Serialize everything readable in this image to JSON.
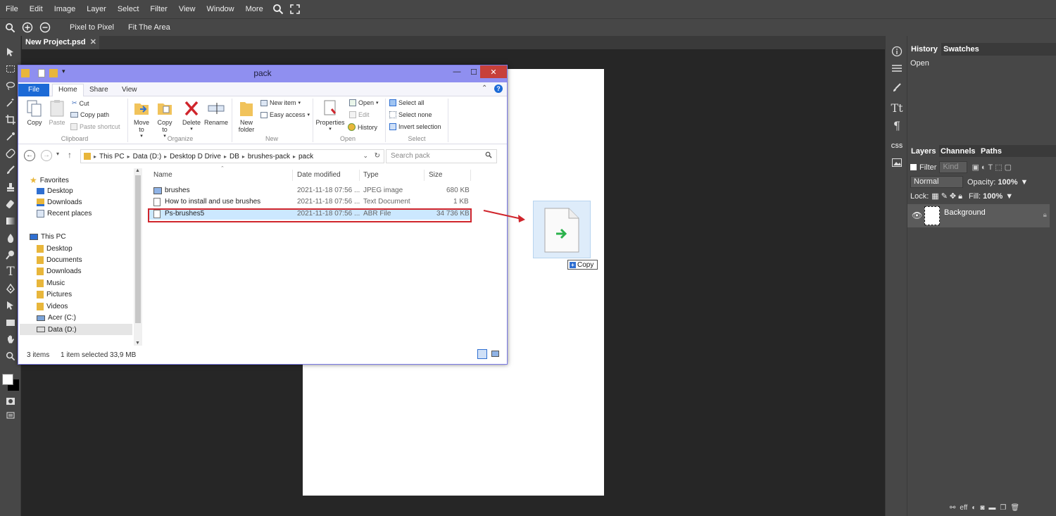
{
  "menubar": {
    "items": [
      "File",
      "Edit",
      "Image",
      "Layer",
      "Select",
      "Filter",
      "View",
      "Window",
      "More"
    ]
  },
  "options": {
    "pixel_to_pixel": "Pixel to Pixel",
    "fit_area": "Fit The Area"
  },
  "document": {
    "tab_name": "New Project.psd",
    "close": "✕"
  },
  "right_panel": {
    "top_tabs": [
      "History",
      "Swatches"
    ],
    "history_items": [
      "Open"
    ],
    "layer_tabs": [
      "Layers",
      "Channels",
      "Paths"
    ],
    "filter_label": "Filter",
    "kind_label": "Kind",
    "blend_mode": "Normal",
    "opacity_label": "Opacity:",
    "opacity_value": "100%",
    "lock_label": "Lock:",
    "fill_label": "Fill:",
    "fill_value": "100%",
    "layer_name": "Background",
    "bottom_icons": "eff"
  },
  "explorer": {
    "title": "pack",
    "tabs": [
      "File",
      "Home",
      "Share",
      "View"
    ],
    "ribbon": {
      "copy": "Copy",
      "paste": "Paste",
      "cut": "Cut",
      "copy_path": "Copy path",
      "paste_shortcut": "Paste shortcut",
      "group_clipboard": "Clipboard",
      "move_to": "Move to",
      "copy_to": "Copy to",
      "delete": "Delete",
      "rename": "Rename",
      "group_organize": "Organize",
      "new_folder": "New folder",
      "new_item": "New item",
      "easy_access": "Easy access",
      "group_new": "New",
      "properties": "Properties",
      "open": "Open",
      "edit": "Edit",
      "history": "History",
      "group_open": "Open",
      "select_all": "Select all",
      "select_none": "Select none",
      "invert_selection": "Invert selection",
      "group_select": "Select"
    },
    "breadcrumb": [
      "This PC",
      "Data (D:)",
      "Desktop D Drive",
      "DB",
      "brushes-pack",
      "pack"
    ],
    "search_placeholder": "Search pack",
    "nav_tree": {
      "favorites": "Favorites",
      "fav_items": [
        "Desktop",
        "Downloads",
        "Recent places"
      ],
      "this_pc": "This PC",
      "pc_items": [
        "Desktop",
        "Documents",
        "Downloads",
        "Music",
        "Pictures",
        "Videos",
        "Acer (C:)",
        "Data (D:)"
      ]
    },
    "columns": [
      "Name",
      "Date modified",
      "Type",
      "Size"
    ],
    "files": [
      {
        "name": "brushes",
        "date": "2021-11-18 07:56 ...",
        "type": "JPEG image",
        "size": "680 KB"
      },
      {
        "name": "How to install and use brushes",
        "date": "2021-11-18 07:56 ...",
        "type": "Text Document",
        "size": "1 KB"
      },
      {
        "name": "Ps-brushes5",
        "date": "2021-11-18 07:56 ...",
        "type": "ABR File",
        "size": "34 736 KB"
      }
    ],
    "status_items": "3 items",
    "status_selected": "1 item selected  33,9 MB"
  },
  "drag": {
    "tooltip": "Copy"
  },
  "colors": {
    "accent_red": "#d0252c",
    "explorer_title": "#8f8ff0",
    "file_tab": "#1c6ad6",
    "app_bg": "#474747"
  }
}
